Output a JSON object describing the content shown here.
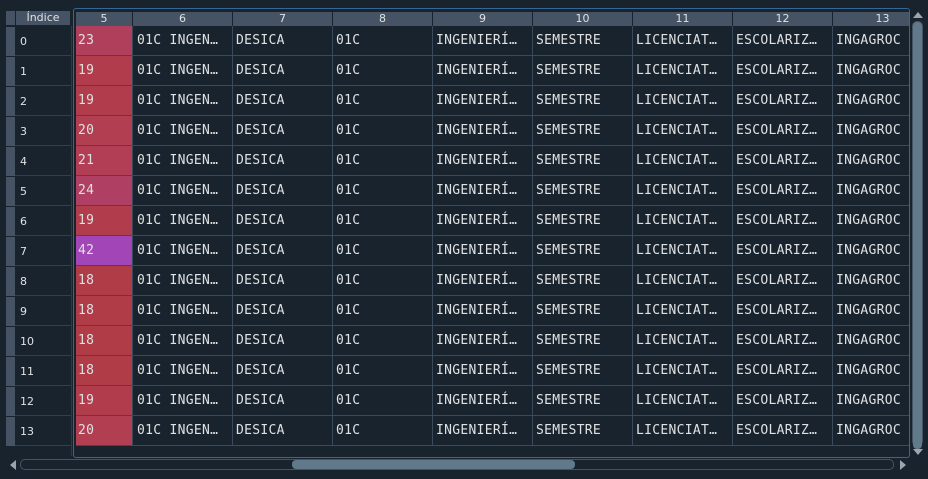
{
  "table": {
    "index_header": "Índice",
    "columns": [
      "5",
      "6",
      "7",
      "8",
      "9",
      "10",
      "11",
      "12",
      "13"
    ],
    "rows": [
      {
        "index": "0",
        "cells": [
          "23",
          "01C INGEN…",
          "DESICA",
          "01C",
          "INGENIERÍ…",
          "SEMESTRE",
          "LICENCIAT…",
          "ESCOLARIZ…",
          "INGAGROC"
        ],
        "heat": "#b03f5c"
      },
      {
        "index": "1",
        "cells": [
          "19",
          "01C INGEN…",
          "DESICA",
          "01C",
          "INGENIERÍ…",
          "SEMESTRE",
          "LICENCIAT…",
          "ESCOLARIZ…",
          "INGAGROC"
        ],
        "heat": "#b13d4c"
      },
      {
        "index": "2",
        "cells": [
          "19",
          "01C INGEN…",
          "DESICA",
          "01C",
          "INGENIERÍ…",
          "SEMESTRE",
          "LICENCIAT…",
          "ESCOLARIZ…",
          "INGAGROC"
        ],
        "heat": "#b13d4c"
      },
      {
        "index": "3",
        "cells": [
          "20",
          "01C INGEN…",
          "DESICA",
          "01C",
          "INGENIERÍ…",
          "SEMESTRE",
          "LICENCIAT…",
          "ESCOLARIZ…",
          "INGAGROC"
        ],
        "heat": "#b13e51"
      },
      {
        "index": "4",
        "cells": [
          "21",
          "01C INGEN…",
          "DESICA",
          "01C",
          "INGENIERÍ…",
          "SEMESTRE",
          "LICENCIAT…",
          "ESCOLARIZ…",
          "INGAGROC"
        ],
        "heat": "#b13e55"
      },
      {
        "index": "5",
        "cells": [
          "24",
          "01C INGEN…",
          "DESICA",
          "01C",
          "INGENIERÍ…",
          "SEMESTRE",
          "LICENCIAT…",
          "ESCOLARIZ…",
          "INGAGROC"
        ],
        "heat": "#b04063"
      },
      {
        "index": "6",
        "cells": [
          "19",
          "01C INGEN…",
          "DESICA",
          "01C",
          "INGENIERÍ…",
          "SEMESTRE",
          "LICENCIAT…",
          "ESCOLARIZ…",
          "INGAGROC"
        ],
        "heat": "#b13d4c"
      },
      {
        "index": "7",
        "cells": [
          "42",
          "01C INGEN…",
          "DESICA",
          "01C",
          "INGENIERÍ…",
          "SEMESTRE",
          "LICENCIAT…",
          "ESCOLARIZ…",
          "INGAGROC"
        ],
        "heat": "#a245b6"
      },
      {
        "index": "8",
        "cells": [
          "18",
          "01C INGEN…",
          "DESICA",
          "01C",
          "INGENIERÍ…",
          "SEMESTRE",
          "LICENCIAT…",
          "ESCOLARIZ…",
          "INGAGROC"
        ],
        "heat": "#b03c47"
      },
      {
        "index": "9",
        "cells": [
          "18",
          "01C INGEN…",
          "DESICA",
          "01C",
          "INGENIERÍ…",
          "SEMESTRE",
          "LICENCIAT…",
          "ESCOLARIZ…",
          "INGAGROC"
        ],
        "heat": "#b03c47"
      },
      {
        "index": "10",
        "cells": [
          "18",
          "01C INGEN…",
          "DESICA",
          "01C",
          "INGENIERÍ…",
          "SEMESTRE",
          "LICENCIAT…",
          "ESCOLARIZ…",
          "INGAGROC"
        ],
        "heat": "#b03c47"
      },
      {
        "index": "11",
        "cells": [
          "18",
          "01C INGEN…",
          "DESICA",
          "01C",
          "INGENIERÍ…",
          "SEMESTRE",
          "LICENCIAT…",
          "ESCOLARIZ…",
          "INGAGROC"
        ],
        "heat": "#b03c47"
      },
      {
        "index": "12",
        "cells": [
          "19",
          "01C INGEN…",
          "DESICA",
          "01C",
          "INGENIERÍ…",
          "SEMESTRE",
          "LICENCIAT…",
          "ESCOLARIZ…",
          "INGAGROC"
        ],
        "heat": "#b13d4c"
      },
      {
        "index": "13",
        "cells": [
          "20",
          "01C INGEN…",
          "DESICA",
          "01C",
          "INGENIERÍ…",
          "SEMESTRE",
          "LICENCIAT…",
          "ESCOLARIZ…",
          "INGAGROC"
        ],
        "heat": "#b13e51"
      }
    ]
  },
  "scroll": {
    "vertical_position": 0.0,
    "horizontal_position": 0.33
  }
}
